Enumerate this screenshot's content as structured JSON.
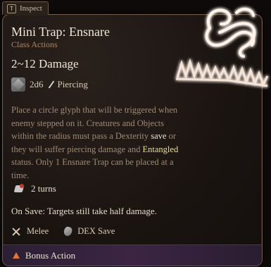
{
  "inspect_tab": {
    "key": "T",
    "label": "Inspect"
  },
  "spell": {
    "title": "Mini Trap: Ensnare",
    "subtitle": "Class Actions",
    "damage_range": "2~12 Damage",
    "damage_dice": "2d6",
    "damage_type": "Piercing",
    "description": {
      "part1": "Place a circle glyph that will be triggered when enemy stepped on it. Creatures and Objects within the radius must pass a Dexterity ",
      "save_word": "save",
      "part2": " or they will suffer piercing damage and ",
      "entangled_word": "Entangled",
      "part3": " status. Only 1 Ensnare Trap can be placed at a time."
    },
    "duration": "2 turns",
    "on_save": "On Save: Targets still take half damage.",
    "tags": {
      "attack_type": "Melee",
      "save_type": "DEX Save"
    },
    "cost": "Bonus Action"
  },
  "colors": {
    "title": "#efe6d8",
    "subtitle": "#b08563",
    "description": "#a08a74",
    "entangled": "#efdf9a",
    "footer_bg": "#3b2543",
    "cost_icon": "#e0773a"
  },
  "icons": {
    "die": "d6-die-icon",
    "piercing": "piercing-icon",
    "duration": "turns-icon",
    "melee": "crossed-swords-icon",
    "save": "shield-icon",
    "cost": "bonus-action-triangle-icon",
    "spell_art": "ensnare-trap-art-icon"
  }
}
